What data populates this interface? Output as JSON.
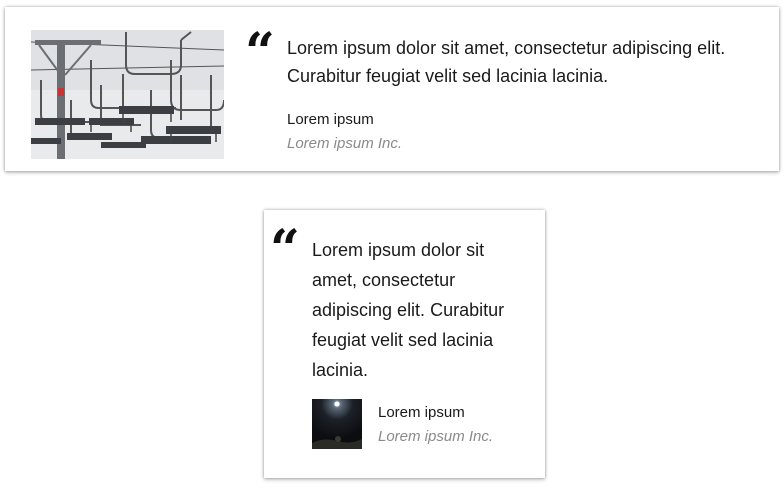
{
  "testimonials": [
    {
      "quote_mark": "“",
      "quote": "Lorem ipsum dolor sit amet, consectetur adipiscing elit. Curabitur feugiat velit sed lacinia lacinia.",
      "author_name": "Lorem ipsum",
      "author_company": "Lorem ipsum Inc.",
      "image": "chairlift-photo"
    },
    {
      "quote_mark": "“",
      "quote": "Lorem ipsum dolor sit amet, consectetur adipiscing elit. Curabitur feugiat velit sed lacinia lacinia.",
      "author_name": "Lorem ipsum",
      "author_company": "Lorem ipsum Inc.",
      "image": "night-sky-avatar"
    }
  ],
  "colors": {
    "text": "#1a1a1a",
    "muted": "#8a8a8a",
    "card_bg": "#ffffff"
  }
}
